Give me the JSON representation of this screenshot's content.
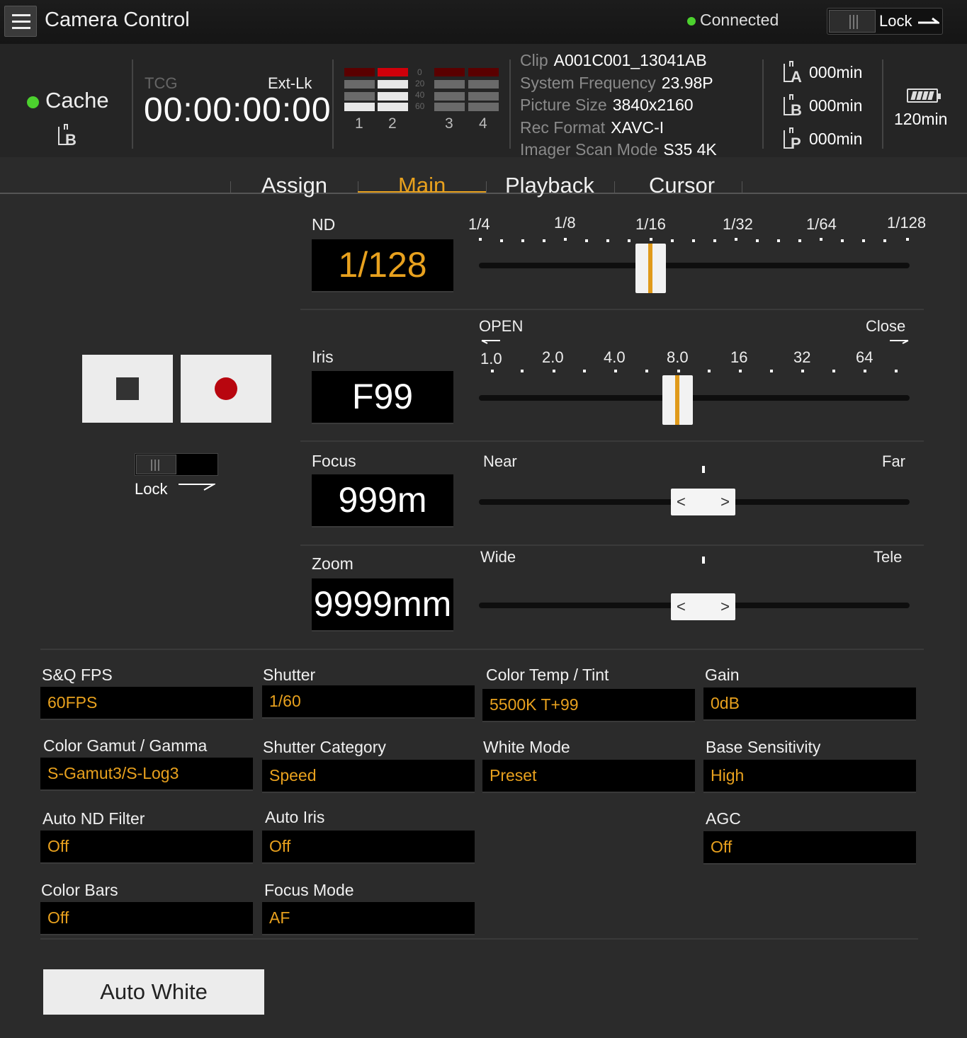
{
  "app": {
    "title": "Camera Control",
    "connection": "Connected",
    "lock_label": "Lock"
  },
  "status": {
    "cache_label": "Cache",
    "cache_media": "B",
    "tcg_label": "TCG",
    "ext_lock": "Ext-Lk",
    "timecode": "00:00:00:00",
    "audio_meter": {
      "channels": [
        "1",
        "2",
        "3",
        "4"
      ],
      "db_scale": [
        "0",
        "20",
        "40",
        "60"
      ]
    },
    "clip_info": [
      {
        "key": "Clip",
        "value": "A001C001_13041AB"
      },
      {
        "key": "System Frequency",
        "value": "23.98P"
      },
      {
        "key": "Picture Size",
        "value": "3840x2160"
      },
      {
        "key": "Rec Format",
        "value": "XAVC-I"
      },
      {
        "key": "Imager Scan Mode",
        "value": "S35 4K"
      }
    ],
    "media_remaining": [
      {
        "slot": "A",
        "value": "000min"
      },
      {
        "slot": "B",
        "value": "000min"
      },
      {
        "slot": "P",
        "value": "000min"
      }
    ],
    "battery": "120min"
  },
  "tabs": [
    {
      "label": "Assign",
      "active": false
    },
    {
      "label": "Main",
      "active": true
    },
    {
      "label": "Playback",
      "active": false
    },
    {
      "label": "Cursor",
      "active": false
    }
  ],
  "controls": {
    "nd": {
      "label": "ND",
      "value": "1/128",
      "value_color": "#e8a11e",
      "scale": [
        "1/4",
        "1/8",
        "1/16",
        "1/32",
        "1/64",
        "1/128"
      ],
      "position": 0.4
    },
    "iris": {
      "label": "Iris",
      "value": "F99",
      "open_label": "OPEN",
      "close_label": "Close",
      "scale": [
        "1.0",
        "2.0",
        "4.0",
        "8.0",
        "16",
        "32",
        "64"
      ],
      "position": 0.46
    },
    "focus": {
      "label": "Focus",
      "value": "999m",
      "min_label": "Near",
      "max_label": "Far",
      "position": 0.52
    },
    "zoom": {
      "label": "Zoom",
      "value": "9999mm",
      "min_label": "Wide",
      "max_label": "Tele",
      "position": 0.52
    }
  },
  "record": {
    "lock_label": "Lock"
  },
  "params": [
    {
      "label": "S&Q FPS",
      "value": "60FPS"
    },
    {
      "label": "Shutter",
      "value": "1/60"
    },
    {
      "label": "Color Temp / Tint",
      "value": "5500K T+99"
    },
    {
      "label": "Gain",
      "value": "0dB"
    },
    {
      "label": "Color Gamut / Gamma",
      "value": "S-Gamut3/S-Log3"
    },
    {
      "label": "Shutter Category",
      "value": "Speed"
    },
    {
      "label": "White Mode",
      "value": "Preset"
    },
    {
      "label": "Base Sensitivity",
      "value": "High"
    },
    {
      "label": "Auto ND Filter",
      "value": "Off"
    },
    {
      "label": "Auto Iris",
      "value": "Off"
    },
    {
      "label": "AGC",
      "value": "Off"
    },
    {
      "label": "Color Bars",
      "value": "Off"
    },
    {
      "label": "Focus Mode",
      "value": "AF"
    }
  ],
  "auto_white_label": "Auto White",
  "colors": {
    "accent": "#e8a11e",
    "record": "#b8060f",
    "connected": "#4cd12e"
  }
}
